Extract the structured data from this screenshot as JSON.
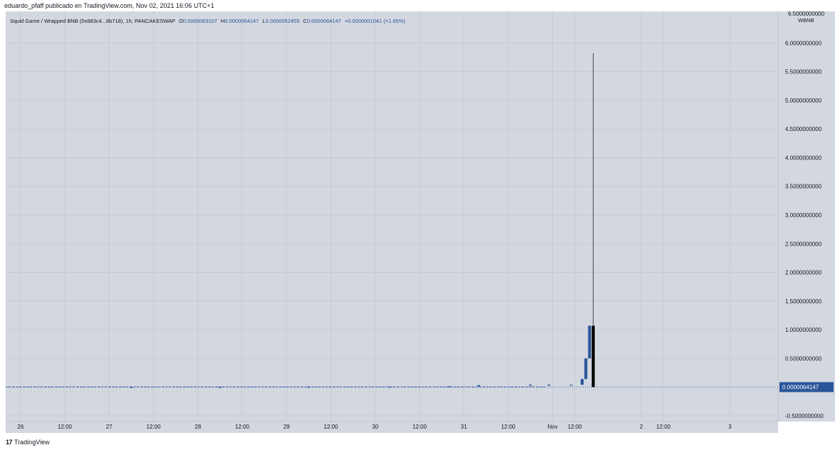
{
  "header": {
    "publish_line": "eduardo_pfaff publicado en TradingView.com, Nov 02, 2021 16:06 UTC+1"
  },
  "legend": {
    "symbol": "Squid Game / Wrapped BNB (0x683c4...8b718), 1h, PANCAKESWAP",
    "o_label": "O",
    "o_value": "0.0000063107",
    "h_label": "H",
    "h_value": "0.0000064147",
    "l_label": "L",
    "l_value": "0.0000062455",
    "c_label": "C",
    "c_value": "0.0000064147",
    "change": "+0.0000001041 (+1.65%)"
  },
  "footer": {
    "brand": "TradingView",
    "logo_glyph": "17"
  },
  "colors": {
    "plot_bg": "#d3d7e0",
    "gridline": "#c3c8d2",
    "up": "#2a5599",
    "down": "#000000",
    "price_tag_bg": "#2a5599",
    "text": "#131722"
  },
  "chart_data": {
    "type": "candlestick",
    "y_axis": {
      "unit": "WBNB",
      "top_label": "6.5000000000",
      "ylim": [
        -0.6,
        6.55
      ],
      "ticks": [
        "6.0000000000",
        "5.5000000000",
        "5.0000000000",
        "4.5000000000",
        "4.0000000000",
        "3.5000000000",
        "3.0000000000",
        "2.5000000000",
        "2.0000000000",
        "1.5000000000",
        "1.0000000000",
        "0.5000000000",
        "0.0000064147",
        "-0.5000000000"
      ],
      "tick_values": [
        6.0,
        5.5,
        5.0,
        4.5,
        4.0,
        3.5,
        3.0,
        2.5,
        2.0,
        1.5,
        1.0,
        0.5,
        6.4147e-06,
        -0.5
      ],
      "last_price": 6.4147e-06,
      "last_price_label": "0.0000064147"
    },
    "x_axis": {
      "ticks": [
        {
          "label": "26",
          "t": 0
        },
        {
          "label": "12:00",
          "t": 12
        },
        {
          "label": "27",
          "t": 24
        },
        {
          "label": "12:00",
          "t": 36
        },
        {
          "label": "28",
          "t": 48
        },
        {
          "label": "12:00",
          "t": 60
        },
        {
          "label": "29",
          "t": 72
        },
        {
          "label": "12:00",
          "t": 84
        },
        {
          "label": "30",
          "t": 96
        },
        {
          "label": "12:00",
          "t": 108
        },
        {
          "label": "31",
          "t": 120
        },
        {
          "label": "12:00",
          "t": 132
        },
        {
          "label": "Nov",
          "t": 144
        },
        {
          "label": "12:00",
          "t": 150
        },
        {
          "label": "2",
          "t": 168
        },
        {
          "label": "12:00",
          "t": 174
        },
        {
          "label": "3",
          "t": 192
        }
      ]
    },
    "candles": [
      {
        "t": 30,
        "o": 0.0,
        "h": 0.001,
        "l": 0.0,
        "c": 0.001
      },
      {
        "t": 54,
        "o": 0.001,
        "h": 0.003,
        "l": 0.001,
        "c": 0.002
      },
      {
        "t": 78,
        "o": 0.002,
        "h": 0.005,
        "l": 0.002,
        "c": 0.004
      },
      {
        "t": 100,
        "o": 0.004,
        "h": 0.01,
        "l": 0.004,
        "c": 0.008
      },
      {
        "t": 116,
        "o": 0.008,
        "h": 0.016,
        "l": 0.008,
        "c": 0.014
      },
      {
        "t": 124,
        "o": 0.014,
        "h": 0.035,
        "l": 0.014,
        "c": 0.035
      },
      {
        "t": 138,
        "o": 0.035,
        "h": 0.05,
        "l": 0.035,
        "c": 0.04
      },
      {
        "t": 143,
        "o": 0.04,
        "h": 0.05,
        "l": 0.035,
        "c": 0.04
      },
      {
        "t": 149,
        "o": 0.04,
        "h": 0.04,
        "l": 0.04,
        "c": 0.04
      },
      {
        "t": 152,
        "o": 0.04,
        "h": 0.14,
        "l": 0.04,
        "c": 0.14
      },
      {
        "t": 153,
        "o": 0.14,
        "h": 0.5,
        "l": 0.14,
        "c": 0.5
      },
      {
        "t": 154,
        "o": 0.5,
        "h": 1.07,
        "l": 0.5,
        "c": 1.07
      },
      {
        "t": 155,
        "o": 1.07,
        "h": 5.82,
        "l": 0.0,
        "c": 0.0
      }
    ],
    "baseline_dashed_range": [
      -8,
      142
    ]
  }
}
